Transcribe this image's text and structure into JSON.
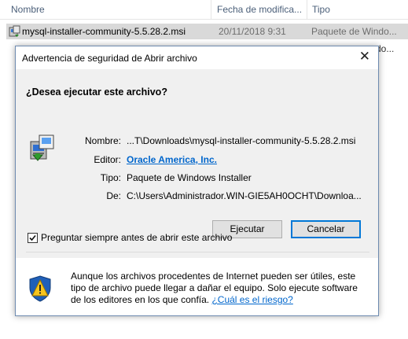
{
  "explorer": {
    "columns": {
      "name": "Nombre",
      "date": "Fecha de modifica...",
      "type": "Tipo"
    },
    "file": {
      "name": "mysql-installer-community-5.5.28.2.msi",
      "date": "20/11/2018 9:31",
      "type": "Paquete de Windo..."
    },
    "peek_text": "do..."
  },
  "dialog": {
    "title": "Advertencia de seguridad de Abrir archivo",
    "question": "¿Desea ejecutar este archivo?",
    "fields": {
      "name_label": "Nombre:",
      "name_value": "...T\\Downloads\\mysql-installer-community-5.5.28.2.msi",
      "publisher_label": "Editor:",
      "publisher_value": "Oracle America, Inc.",
      "type_label": "Tipo:",
      "type_value": "Paquete de Windows Installer",
      "from_label": "De:",
      "from_value": "C:\\Users\\Administrador.WIN-GIE5AH0OCHT\\Downloa..."
    },
    "buttons": {
      "run": "Ejecutar",
      "cancel": "Cancelar"
    },
    "checkbox": {
      "label": "Preguntar siempre antes de abrir este archivo",
      "checked": true
    },
    "warning": {
      "text": "Aunque los archivos procedentes de Internet pueden ser útiles, este tipo de archivo puede llegar a dañar el equipo. Solo ejecute software de los editores en los que confía. ",
      "link": "¿Cuál es el riesgo?"
    }
  },
  "colors": {
    "link": "#0066cc",
    "accent": "#0078d7",
    "dialog_body": "#f0f0f0",
    "selected_row": "#d9d9d9"
  },
  "icons": [
    "msi-package-icon",
    "close-icon",
    "checkmark-icon",
    "warning-shield-icon"
  ]
}
